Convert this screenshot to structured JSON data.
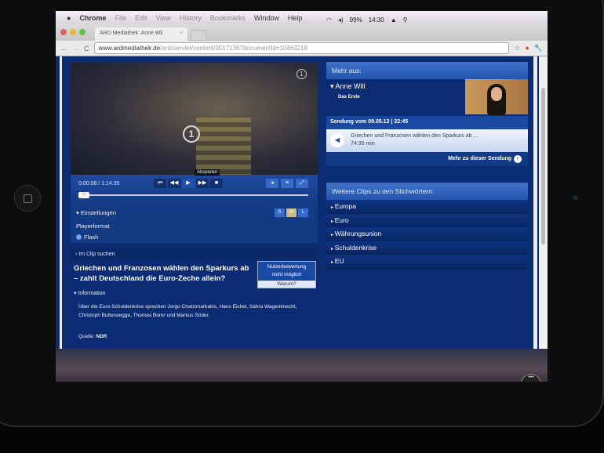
{
  "menubar": {
    "apple": "",
    "items": [
      "Chrome",
      "File",
      "Edit",
      "View",
      "History",
      "Bookmarks",
      "Window",
      "Help"
    ],
    "battery": "99%",
    "clock": "14:30"
  },
  "tab": {
    "title": "ARD Mediathek: Anne Wil",
    "close": "×"
  },
  "address": {
    "host": "www.ardmediathek.de",
    "path": "/ard/servlet/content/3517136?documentId=10463218"
  },
  "player": {
    "time": "0:00:08 / 1:14:35",
    "tooltip": "Abspielen",
    "progress": 0.002,
    "sizes": [
      "S",
      "M",
      "L"
    ],
    "selected_size": "M",
    "settings_label": "Einstellungen",
    "format_label": "Playerformat",
    "format_value": "Flash"
  },
  "clip": {
    "search": "Im Clip suchen",
    "title": "Griechen und Franzosen wählen den Sparkurs ab – zahlt Deutschland die Euro-Zeche allein?",
    "rating_1": "Nutzerbewertung",
    "rating_2": "nicht möglich",
    "rating_why": "Warum?",
    "info_label": "Information",
    "info_text": "Über die Euro-Schuldenkrise sprechen Jorgo Chatzimarkakis, Hans Eichel, Sahra Wagenknecht, Christoph Butterwegge, Thomas Borer und Markus Söder.",
    "source_label": "Quelle:",
    "source": "NDR"
  },
  "sidebar": {
    "more_from": "Mehr aus:",
    "show": "Anne Will",
    "channel": "Das Erste",
    "broadcast": "Sendung vom 09.05.12 | 22:45",
    "episode_title": "Griechen und Franzosen wählen den Sparkurs ab ...",
    "episode_length": "74:35 min",
    "more_link": "Mehr zu dieser Sendung",
    "keywords_header": "Weitere Clips zu den Stichwörtern:",
    "keywords": [
      "Europa",
      "Euro",
      "Währungsunion",
      "Schuldenkrise",
      "EU"
    ]
  }
}
